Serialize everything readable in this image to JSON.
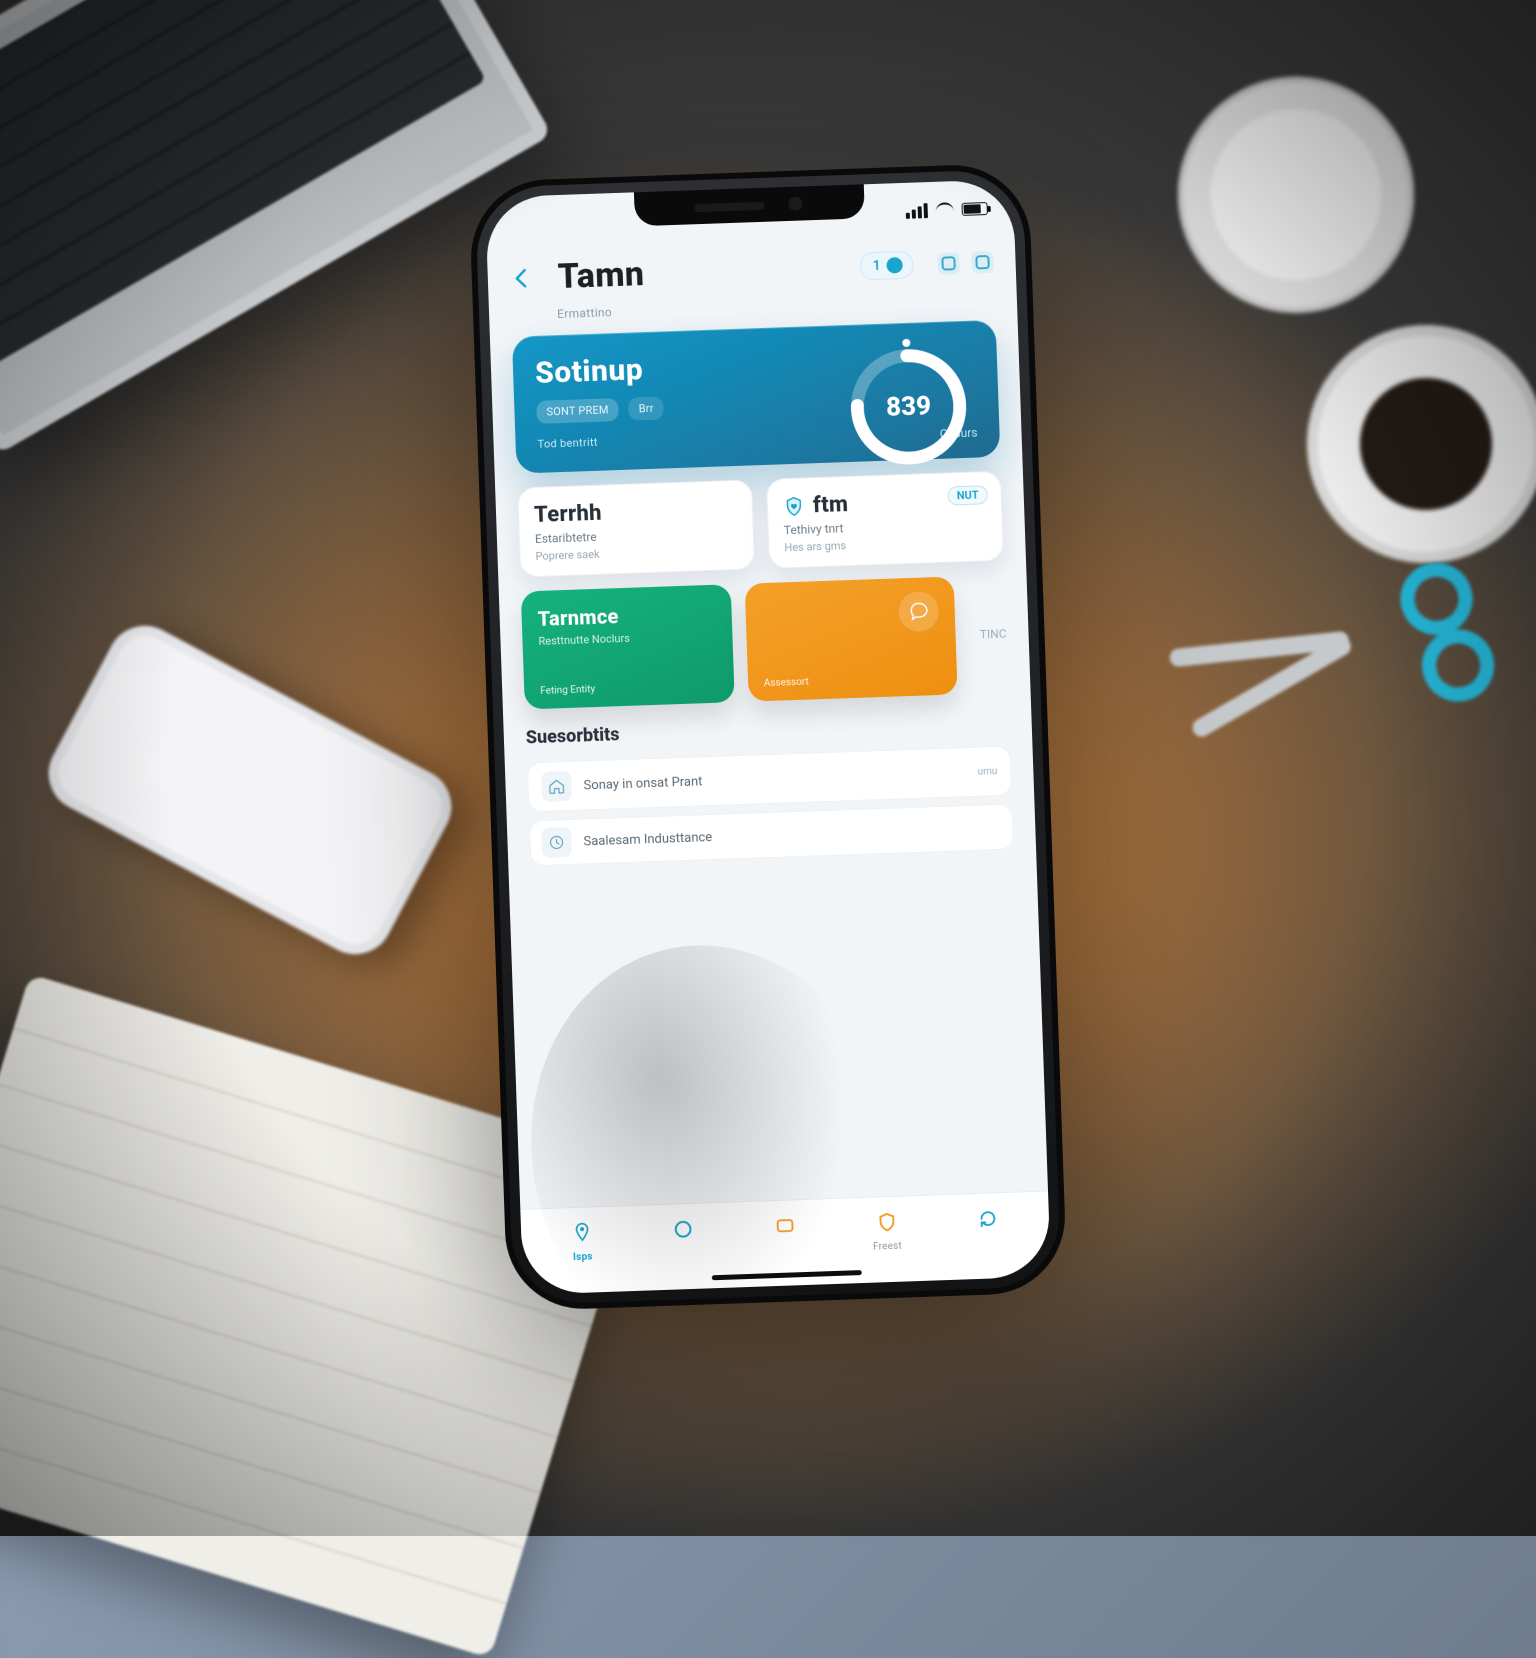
{
  "statusbar": {
    "time": ""
  },
  "header": {
    "title": "Tamn",
    "badge_text": "1",
    "breadcrumb": "Ermattino"
  },
  "hero": {
    "title": "Sotinup",
    "ring_value": "839",
    "pills": [
      "SONT PREM",
      "Brr"
    ],
    "subline": "Tod bentritt",
    "link": "Cosurs"
  },
  "cards": {
    "left": {
      "title": "Terrhh",
      "line1": "Estaribtetre",
      "line2": "Poprere saek"
    },
    "right": {
      "title": "ftm",
      "line1": "Tethivy tnrt",
      "line2": "Hes ars gms",
      "badge": "NUT"
    }
  },
  "tiles": {
    "green": {
      "title": "Tarnmce",
      "sub": "Resttnutte Noclurs",
      "footer": "Feting Entity"
    },
    "orange": {
      "title": "",
      "sub": "",
      "footer": "Assessort"
    },
    "side_label": "TINC"
  },
  "section": {
    "title": "Suesorbtits",
    "items": [
      {
        "text": "Sonay in onsat Prant"
      },
      {
        "text": "Saalesam Industtance"
      }
    ],
    "row_tag": "umu"
  },
  "tabs": [
    {
      "label": "Isps",
      "icon": "pin"
    },
    {
      "label": "",
      "icon": "ring"
    },
    {
      "label": "",
      "icon": "card"
    },
    {
      "label": "Freest",
      "icon": "shield"
    },
    {
      "label": "",
      "icon": "refresh"
    }
  ],
  "colors": {
    "accent": "#1aa5cf",
    "hero_from": "#1597c6",
    "hero_to": "#1f6a90",
    "green": "#12a875",
    "orange": "#f19a22"
  },
  "icons": {
    "back": "chevron-left",
    "header_badge": "dot-circle",
    "hero_ring": "progress-ring",
    "card_right": "shield-heart",
    "tile_orange": "chat-bubble",
    "list_0": "house",
    "list_1": "clock",
    "tab_0": "pin",
    "tab_1": "ring",
    "tab_2": "card",
    "tab_3": "shield",
    "tab_4": "refresh"
  }
}
